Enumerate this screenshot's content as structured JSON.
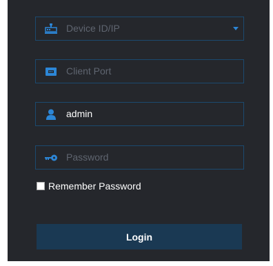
{
  "login_form": {
    "device": {
      "placeholder": "Device ID/IP",
      "icon": "network-device-icon"
    },
    "port": {
      "placeholder": "Client Port",
      "icon": "port-icon"
    },
    "username": {
      "value": "admin",
      "icon": "user-icon"
    },
    "password": {
      "placeholder": "Password",
      "icon": "key-icon"
    },
    "remember": {
      "label": "Remember Password",
      "checked": false
    },
    "login_label": "Login"
  },
  "colors": {
    "panel_background": "#25272c",
    "field_border": "#1b4a70",
    "accent": "#2c86d6",
    "button_background": "#1a3953",
    "placeholder_text": "#5f6570"
  }
}
